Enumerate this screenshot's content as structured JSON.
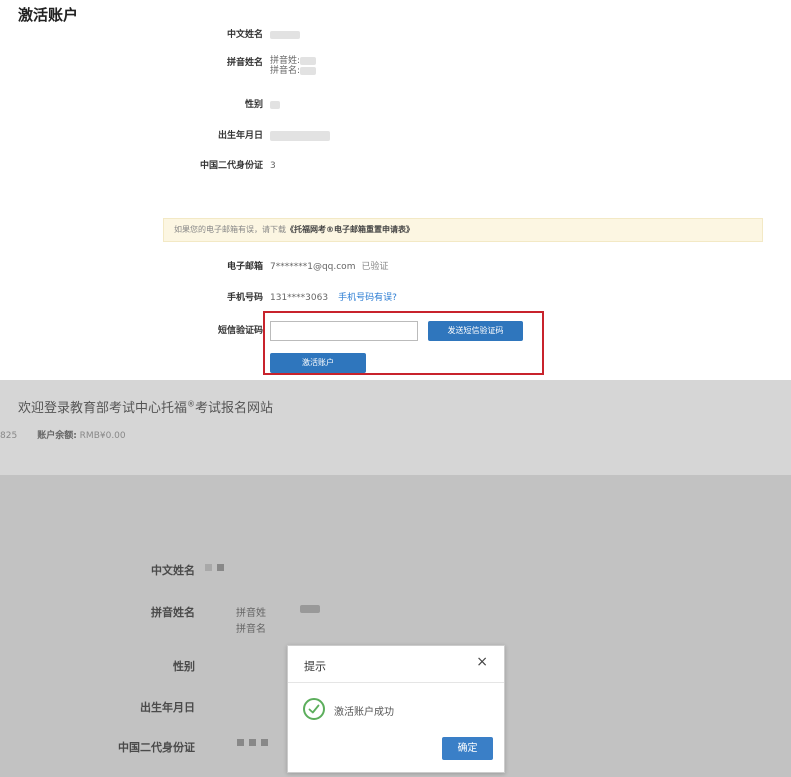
{
  "page_title": "激活账户",
  "form": {
    "chinese_name_label": "中文姓名",
    "pinyin_name_label": "拼音姓名",
    "pinyin_surname_label": "拼音姓:",
    "pinyin_given_label": "拼音名:",
    "gender_label": "性别",
    "dob_label": "出生年月日",
    "id_label": "中国二代身份证",
    "id_value": "3",
    "notice_text": "如果您的电子邮箱有误，请下载",
    "notice_link": "《托福网考®电子邮箱重置申请表》",
    "email_label": "电子邮箱",
    "email_value": "7*******1@qq.com",
    "email_status": "已验证",
    "phone_label": "手机号码",
    "phone_value": "131****3063",
    "phone_error_link": "手机号码有误?",
    "sms_label": "短信验证码",
    "sms_input_value": "",
    "send_sms_button": "发送短信验证码",
    "activate_button": "激活账户"
  },
  "bottom": {
    "welcome_text": "欢迎登录教育部考试中心托福",
    "welcome_sup": "®",
    "welcome_suffix": "考试报名网站",
    "acct_id_fragment": "825",
    "balance_label": "账户余额:",
    "balance_value": "RMB¥0.00",
    "chinese_name_label": "中文姓名",
    "pinyin_name_label": "拼音姓名",
    "pinyin_surname_label": "拼音姓",
    "pinyin_given_label": "拼音名",
    "gender_label": "性别",
    "dob_label": "出生年月日",
    "id_label": "中国二代身份证"
  },
  "dialog": {
    "title": "提示",
    "close_glyph": "×",
    "message": "激活账户成功",
    "ok_button": "确定",
    "icon": "check-circle-icon"
  },
  "colors": {
    "primary_blue": "#2f76bd",
    "highlight_red": "#c8232c",
    "success_green": "#5cae5c",
    "notice_bg": "#fcf6e2"
  }
}
